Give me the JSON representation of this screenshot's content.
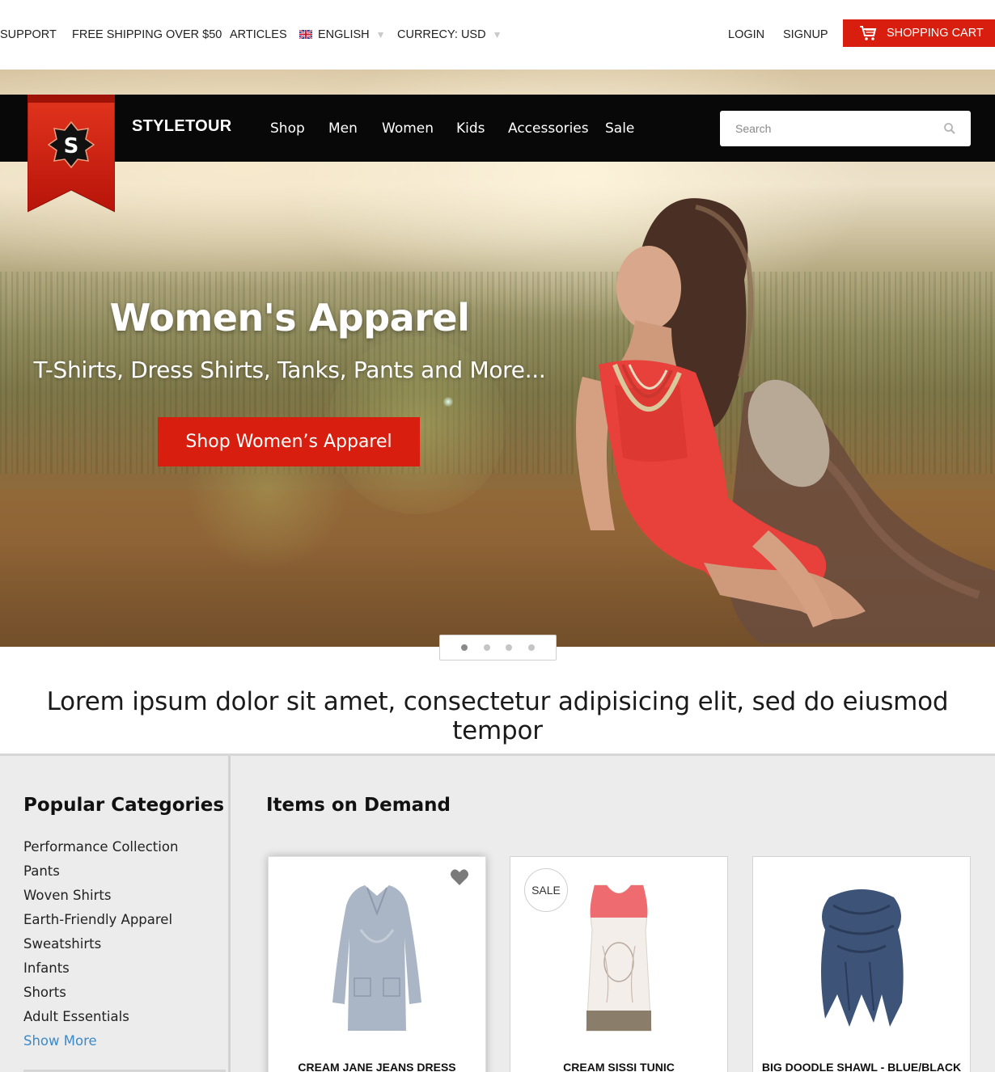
{
  "topbar": {
    "support": "SUPPORT",
    "shipping": "FREE SHIPPING OVER $50",
    "articles": "ARTICLES",
    "language": "ENGLISH",
    "currency": "CURRECY: USD",
    "login": "LOGIN",
    "signup": "SIGNUP",
    "cart": "SHOPPING CART"
  },
  "nav": {
    "brand": "STYLETOUR",
    "logo_letter": "S",
    "links": [
      "Shop",
      "Men",
      "Women",
      "Kids",
      "Accessories",
      "Sale"
    ],
    "search_placeholder": "Search"
  },
  "hero": {
    "title": "Women's Apparel",
    "subtitle": "T-Shirts, Dress Shirts, Tanks, Pants and More...",
    "cta": "Shop Women’s Apparel",
    "slides": 4,
    "active_slide": 1
  },
  "tagline": "Lorem ipsum dolor sit amet, consectetur adipisicing elit, sed do eiusmod tempor",
  "sidebar": {
    "title": "Popular Categories",
    "categories": [
      "Performance Collection",
      "Pants",
      "Woven Shirts",
      "Earth-Friendly Apparel",
      "Sweatshirts",
      "Infants",
      "Shorts",
      "Adult Essentials"
    ],
    "show_more": "Show More"
  },
  "items": {
    "title": "Items on Demand",
    "products": [
      {
        "name": "CREAM JANE JEANS DRESS",
        "badge": "",
        "icon": "heart-icon"
      },
      {
        "name": "CREAM SISSI TUNIC",
        "badge": "SALE",
        "icon": ""
      },
      {
        "name": "BIG DOODLE SHAWL - BLUE/BLACK",
        "badge": "",
        "icon": ""
      }
    ]
  },
  "colors": {
    "accent_red": "#d81e0e",
    "nav_black": "#080808",
    "link_blue": "#3b8ac9",
    "lower_bg": "#ececec"
  }
}
